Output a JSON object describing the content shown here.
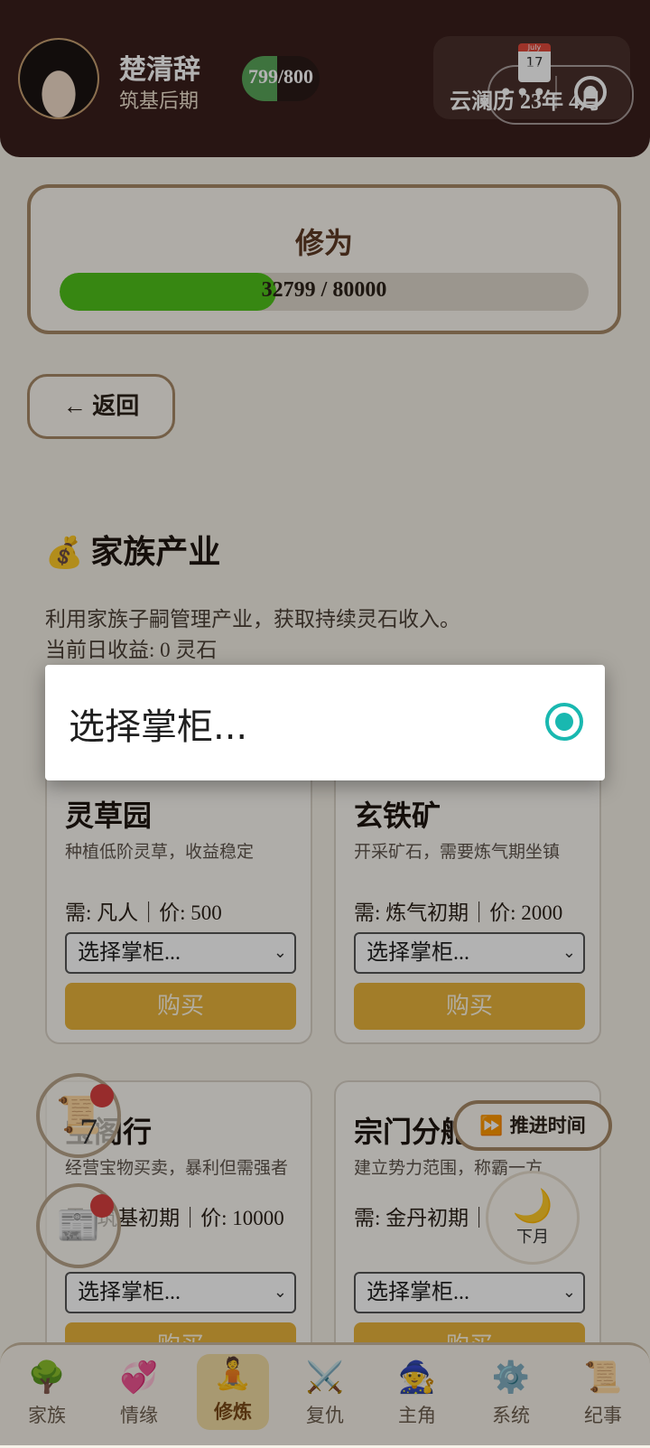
{
  "header": {
    "name": "楚清辞",
    "realm": "筑基后期",
    "hp_text": "799/800",
    "hp_fraction": 0.45,
    "calendar_month": "July",
    "calendar_day": "17",
    "date": "云澜历 23年 4月",
    "capsule_dots": "•••"
  },
  "cultivation": {
    "title": "修为",
    "progress_text": "32799 / 80000",
    "current": 32799,
    "max": 80000
  },
  "back_label": "← 返回",
  "section": {
    "icon": "💰",
    "title": "家族产业",
    "desc": "利用家族子嗣管理产业，获取持续灵石收入。",
    "income": "当前日收益: 0 灵石"
  },
  "cards": [
    {
      "title": "灵草园",
      "desc": "种植低阶灵草，收益稳定",
      "req": "需: 凡人｜价: 500",
      "select": "选择掌柜...",
      "buy": "购买"
    },
    {
      "title": "玄铁矿",
      "desc": "开采矿石，需要炼气期坐镇",
      "req": "需: 炼气初期｜价: 2000",
      "select": "选择掌柜...",
      "buy": "购买"
    },
    {
      "title": "宝阁行",
      "desc": "经营宝物买卖，暴利但需强者",
      "req": "需: 筑基初期｜价: 10000",
      "select": "选择掌柜...",
      "buy": "购买"
    },
    {
      "title": "宗门分舵",
      "desc": "建立势力范围，称霸一方",
      "req": "需: 金丹初期｜价: 50000",
      "select": "选择掌柜...",
      "buy": "购买"
    }
  ],
  "floating": {
    "scroll_badge": "7",
    "push_time": "⏩ 推进时间",
    "moon_icon": "🌙",
    "next_month": "下月"
  },
  "nav": [
    {
      "icon": "🌳",
      "label": "家族"
    },
    {
      "icon": "💞",
      "label": "情缘"
    },
    {
      "icon": "🧘",
      "label": "修炼"
    },
    {
      "icon": "⚔️",
      "label": "复仇"
    },
    {
      "icon": "🧙",
      "label": "主角"
    },
    {
      "icon": "⚙️",
      "label": "系统"
    },
    {
      "icon": "📜",
      "label": "纪事"
    }
  ],
  "active_nav": "修炼",
  "dialog": {
    "option": "选择掌柜...",
    "selected": true
  },
  "colors": {
    "header_bg": "#3a1f1c",
    "progress_fill": "#4fc21a",
    "buy_button": "#e8b43c",
    "radio_accent": "#19b8b0"
  }
}
